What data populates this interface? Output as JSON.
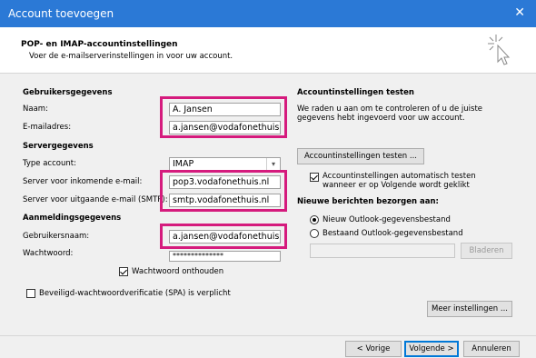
{
  "window": {
    "title": "Account toevoegen",
    "close_label": "✕"
  },
  "header": {
    "heading": "POP- en IMAP-accountinstellingen",
    "subheading": "Voer de e-mailserverinstellingen in voor uw account."
  },
  "user_info": {
    "section": "Gebruikersgegevens",
    "name_label": "Naam:",
    "name_value": "A. Jansen",
    "email_label": "E-mailadres:",
    "email_value": "a.jansen@vodafonethuis.r"
  },
  "server_info": {
    "section": "Servergegevens",
    "account_type_label": "Type account:",
    "account_type_value": "IMAP",
    "incoming_label": "Server voor inkomende e-mail:",
    "incoming_value": "pop3.vodafonethuis.nl",
    "outgoing_label": "Server voor uitgaande e-mail (SMTP):",
    "outgoing_value": "smtp.vodafonethuis.nl"
  },
  "login_info": {
    "section": "Aanmeldingsgegevens",
    "username_label": "Gebruikersnaam:",
    "username_value": "a.jansen@vodafonethuis.r",
    "password_label": "Wachtwoord:",
    "password_value": "**************",
    "remember_label": "Wachtwoord onthouden",
    "remember_checked": true,
    "spa_label": "Beveiligd-wachtwoordverificatie (SPA) is verplicht",
    "spa_checked": false
  },
  "test_settings": {
    "section": "Accountinstellingen testen",
    "description_line1": "We raden u aan om te controleren of u de juiste",
    "description_line2": "gegevens hebt ingevoerd voor uw account.",
    "test_button": "Accountinstellingen testen ...",
    "auto_test_line1": "Accountinstellingen automatisch testen",
    "auto_test_line2": "wanneer er op Volgende wordt geklikt",
    "auto_test_checked": true
  },
  "deliver_to": {
    "section": "Nieuwe berichten bezorgen aan:",
    "option_new": "Nieuw Outlook-gegevensbestand",
    "option_existing": "Bestaand Outlook-gegevensbestand",
    "selected": "new",
    "browse_button": "Bladeren"
  },
  "more_settings_button": "Meer instellingen ...",
  "footer": {
    "back_button": "< Vorige",
    "next_button": "Volgende >",
    "cancel_button": "Annuleren"
  },
  "colors": {
    "titlebar": "#2b79d6",
    "highlight": "#d51b7d",
    "background": "#f0f0f0"
  }
}
